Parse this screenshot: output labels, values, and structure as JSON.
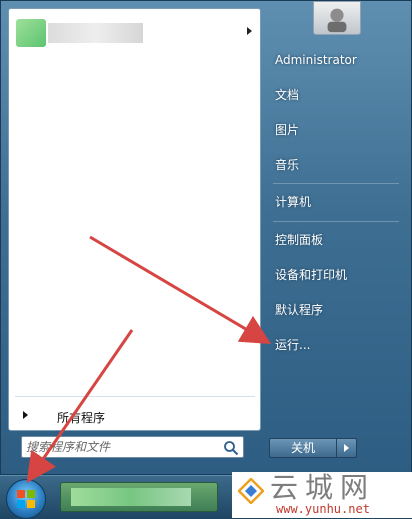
{
  "start_menu": {
    "all_programs_label": "所有程序",
    "search_placeholder": "搜索程序和文件",
    "right_items": [
      "Administrator",
      "文档",
      "图片",
      "音乐",
      "计算机",
      "控制面板",
      "设备和打印机",
      "默认程序",
      "运行..."
    ],
    "shutdown_label": "关机"
  },
  "watermark": {
    "text": "云城网",
    "url": "www.yunhu.net"
  },
  "colors": {
    "annotation_arrow": "#d64541",
    "menu_blue": "#3e6f93"
  }
}
